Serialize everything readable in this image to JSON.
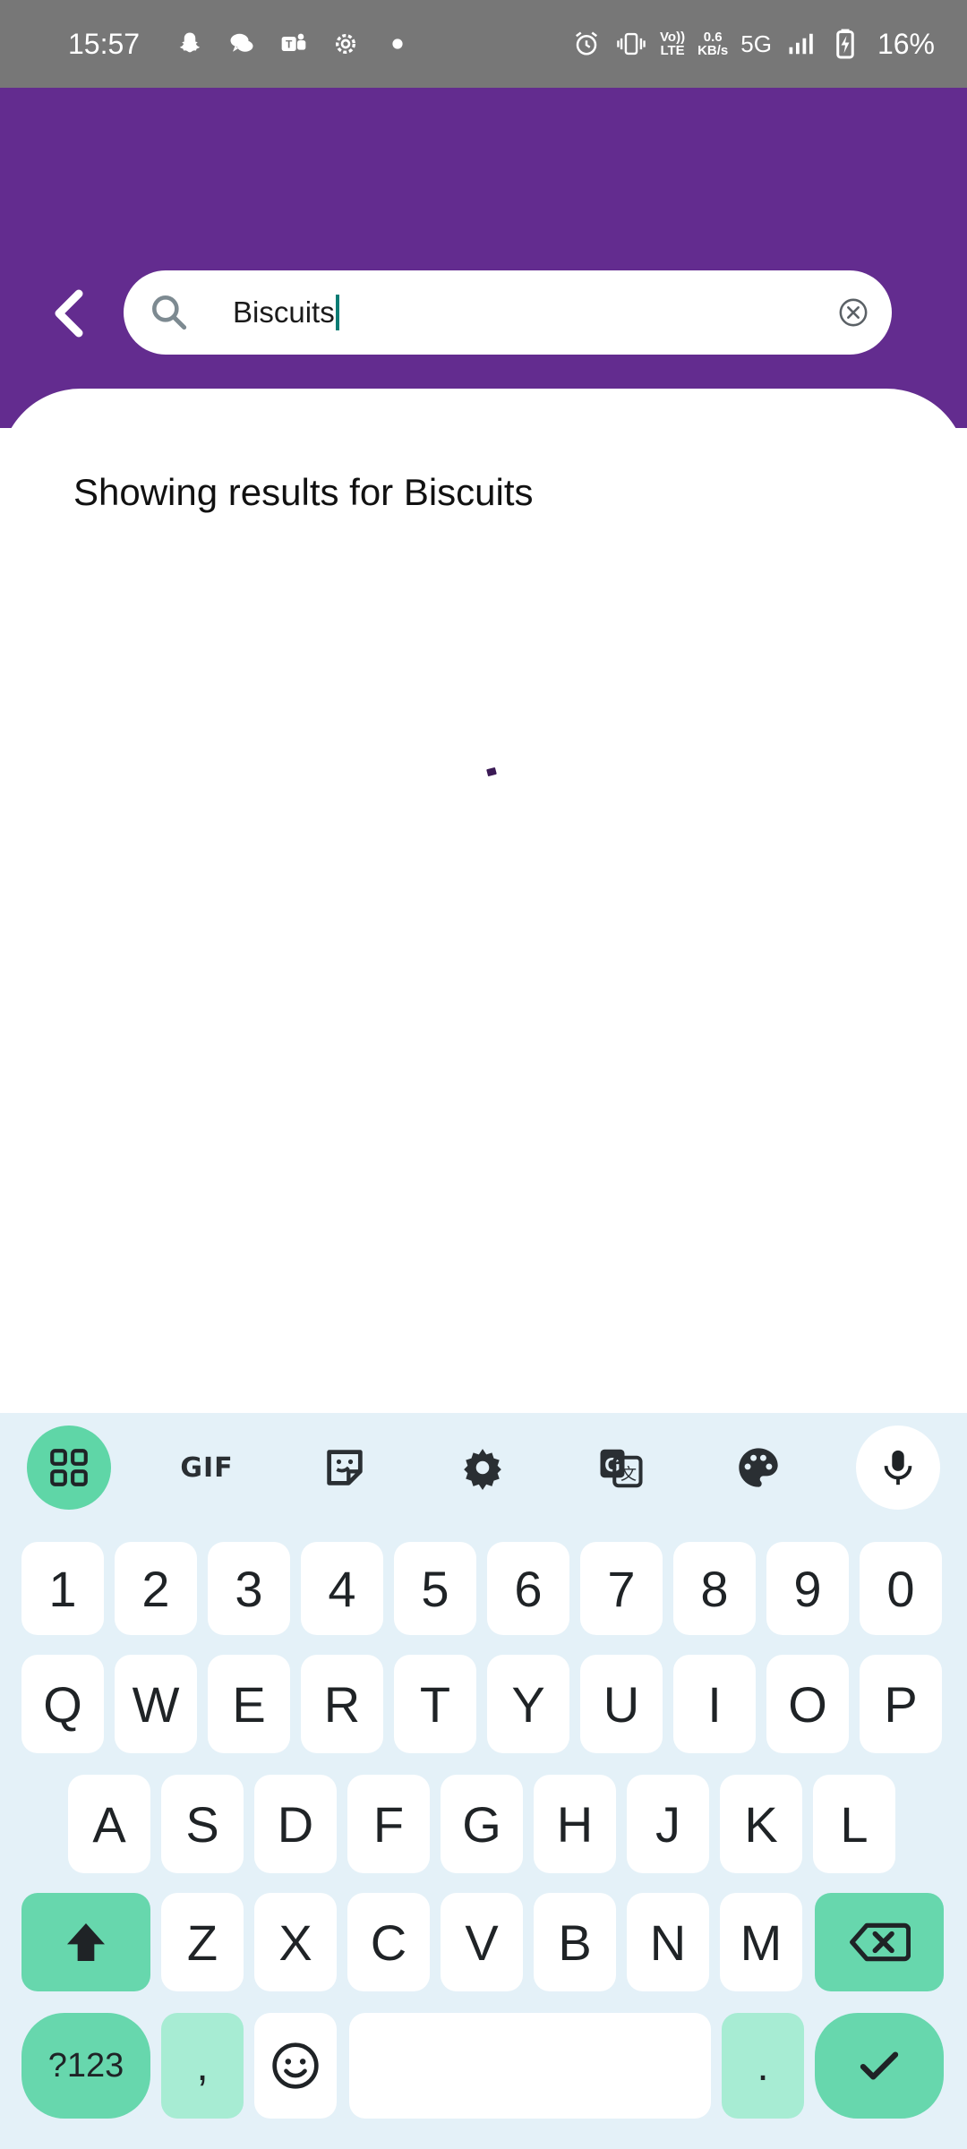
{
  "status_bar": {
    "time": "15:57",
    "network_speed_value": "0.6",
    "network_speed_unit": "KB/s",
    "volte_top": "Vo))",
    "volte_bottom": "LTE",
    "network_type": "5G",
    "battery_percent": "16%"
  },
  "search": {
    "query": "Biscuits"
  },
  "results": {
    "text": "Showing results for Biscuits"
  },
  "keyboard": {
    "toolbar": {
      "gif_label": "GIF"
    },
    "number_row": [
      "1",
      "2",
      "3",
      "4",
      "5",
      "6",
      "7",
      "8",
      "9",
      "0"
    ],
    "row1": [
      "Q",
      "W",
      "E",
      "R",
      "T",
      "Y",
      "U",
      "I",
      "O",
      "P"
    ],
    "row2": [
      "A",
      "S",
      "D",
      "F",
      "G",
      "H",
      "J",
      "K",
      "L"
    ],
    "row3": [
      "Z",
      "X",
      "C",
      "V",
      "B",
      "N",
      "M"
    ],
    "symbols_label": "?123",
    "comma_label": ",",
    "period_label": "."
  },
  "colors": {
    "header": "#632c8f",
    "accent_green": "#67d7ad",
    "keyboard_bg": "#e4f1f8"
  }
}
